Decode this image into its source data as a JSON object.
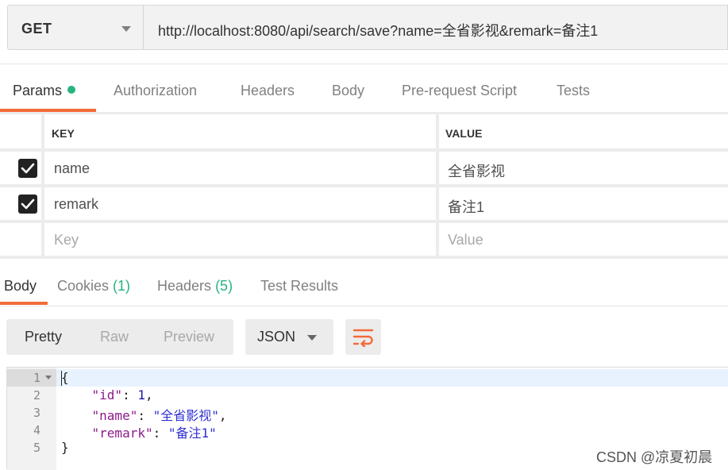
{
  "request": {
    "method": "GET",
    "url": "http://localhost:8080/api/search/save?name=全省影视&remark=备注1"
  },
  "request_tabs": [
    {
      "label": "Params",
      "active": true,
      "indicator": "green-dot"
    },
    {
      "label": "Authorization"
    },
    {
      "label": "Headers"
    },
    {
      "label": "Body"
    },
    {
      "label": "Pre-request Script"
    },
    {
      "label": "Tests"
    }
  ],
  "params": {
    "columns": {
      "key": "KEY",
      "value": "VALUE"
    },
    "rows": [
      {
        "checked": true,
        "key": "name",
        "value": "全省影视"
      },
      {
        "checked": true,
        "key": "remark",
        "value": "备注1"
      }
    ],
    "placeholder_row": {
      "key": "Key",
      "value": "Value"
    }
  },
  "response_tabs": {
    "body": "Body",
    "cookies": {
      "label": "Cookies",
      "count": "(1)"
    },
    "headers": {
      "label": "Headers",
      "count": "(5)"
    },
    "test_results": "Test Results"
  },
  "view_modes": {
    "pretty": "Pretty",
    "raw": "Raw",
    "preview": "Preview",
    "active": "Pretty"
  },
  "format": "JSON",
  "wrap_icon": "wrap-lines-icon",
  "code": {
    "line_numbers": [
      "1",
      "2",
      "3",
      "4",
      "5"
    ],
    "lines": {
      "l1": "{",
      "l2_key": "\"id\"",
      "l2_colon": ": ",
      "l2_val": "1",
      "l2_end": ",",
      "l3_key": "\"name\"",
      "l3_colon": ": ",
      "l3_val": "\"全省影视\"",
      "l3_end": ",",
      "l4_key": "\"remark\"",
      "l4_colon": ": ",
      "l4_val": "\"备注1\"",
      "l5": "}"
    }
  },
  "watermark": "CSDN @凉夏初晨",
  "colors": {
    "accent": "#f26b3a",
    "success": "#26b47f",
    "json_key": "#8b1a8b",
    "json_string": "#3030d0"
  }
}
